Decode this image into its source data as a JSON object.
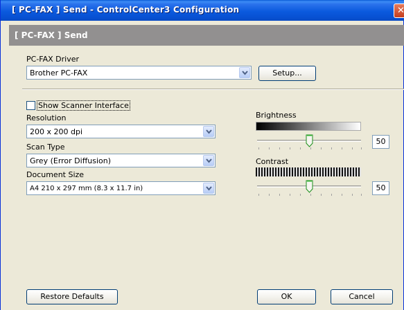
{
  "window": {
    "title": "[ PC-FAX ]  Send - ControlCenter3 Configuration"
  },
  "header": {
    "title": "[ PC-FAX ]  Send"
  },
  "driver": {
    "label": "PC-FAX Driver",
    "value": "Brother PC-FAX",
    "setup_label": "Setup..."
  },
  "scanner": {
    "show_interface_label": "Show Scanner Interface",
    "show_interface_checked": false
  },
  "resolution": {
    "label": "Resolution",
    "value": "200 x 200 dpi"
  },
  "scan_type": {
    "label": "Scan Type",
    "value": "Grey (Error Diffusion)"
  },
  "document_size": {
    "label": "Document Size",
    "value": "A4 210 x 297 mm (8.3 x 11.7 in)"
  },
  "brightness": {
    "label": "Brightness",
    "value": "50",
    "level_fraction": 0.5
  },
  "contrast": {
    "label": "Contrast",
    "value": "50",
    "level_fraction": 0.5
  },
  "buttons": {
    "restore_defaults": "Restore Defaults",
    "ok": "OK",
    "cancel": "Cancel"
  },
  "colors": {
    "title_bar": "#0b5ade",
    "header_band": "#929090",
    "dialog_bg": "#ece9d8",
    "close_button": "#c43d1e"
  },
  "icons": {
    "close": "close-icon",
    "dropdown": "chevron-down-icon",
    "slider_thumb": "slider-thumb-icon"
  }
}
